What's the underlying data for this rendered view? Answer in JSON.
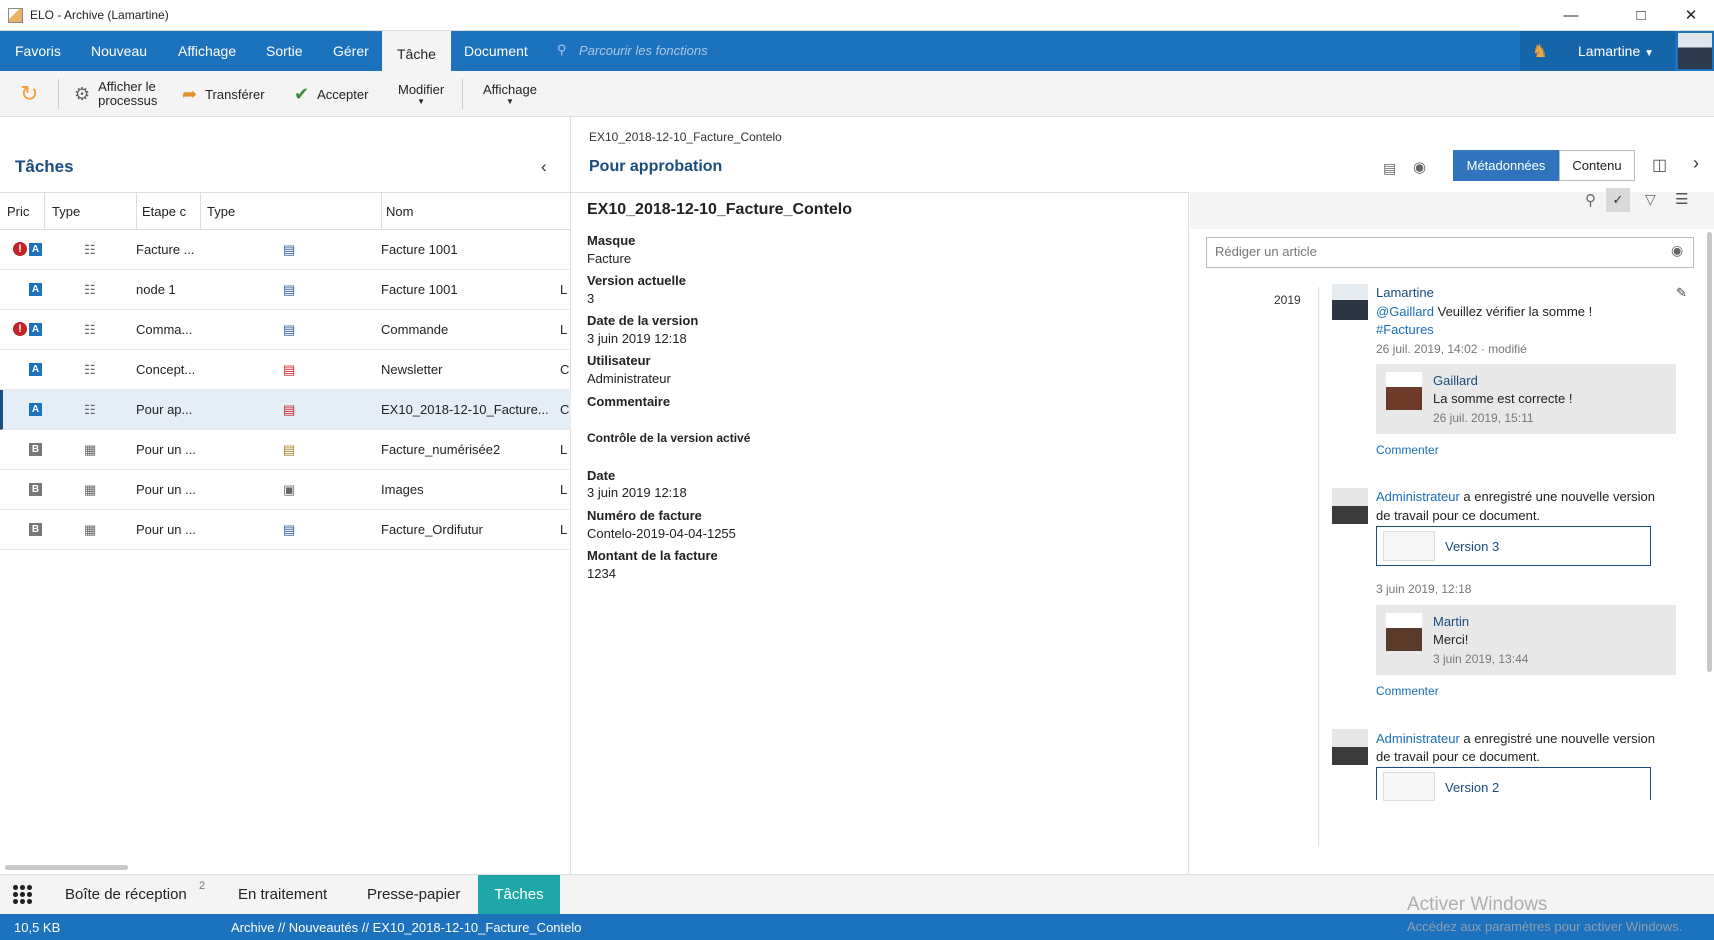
{
  "window": {
    "title": "ELO - Archive (Lamartine)"
  },
  "ribbon": {
    "tabs": [
      "Favoris",
      "Nouveau",
      "Affichage",
      "Sortie",
      "Gérer",
      "Tâche",
      "Document"
    ],
    "active": "Tâche",
    "search_placeholder": "Parcourir les fonctions",
    "user": "Lamartine"
  },
  "toolbar": {
    "refresh": "",
    "process": "Afficher le processus",
    "process_l1": "Afficher le",
    "process_l2": "processus",
    "transfer": "Transférer",
    "accept": "Accepter",
    "modify": "Modifier",
    "display": "Affichage"
  },
  "left": {
    "title": "Tâches",
    "columns": [
      "Pric",
      "Type",
      "Etape c",
      "Type",
      "Nom"
    ],
    "rows": [
      {
        "warn": true,
        "badge": "A",
        "step": "Facture ...",
        "name": "Facture 1001",
        "extra": ""
      },
      {
        "warn": false,
        "badge": "A",
        "step": "node 1",
        "name": "Facture 1001",
        "extra": "L"
      },
      {
        "warn": true,
        "badge": "A",
        "step": "Comma...",
        "name": "Commande",
        "extra": "L"
      },
      {
        "warn": false,
        "badge": "A",
        "step": "Concept...",
        "name": "Newsletter",
        "extra": "C"
      },
      {
        "warn": false,
        "badge": "A",
        "step": "Pour ap...",
        "name": "EX10_2018-12-10_Facture...",
        "extra": "C"
      },
      {
        "warn": false,
        "badge": "B",
        "step": "Pour un ...",
        "name": "Facture_numérisée2",
        "extra": "L"
      },
      {
        "warn": false,
        "badge": "B",
        "step": "Pour un ...",
        "name": "Images",
        "extra": "L"
      },
      {
        "warn": false,
        "badge": "B",
        "step": "Pour un ...",
        "name": "Facture_Ordifutur",
        "extra": "L"
      }
    ]
  },
  "doc": {
    "path": "EX10_2018-12-10_Facture_Contelo",
    "task": "Pour approbation",
    "metadata_tab": "Métadonnées",
    "content_tab": "Contenu",
    "title": "EX10_2018-12-10_Facture_Contelo"
  },
  "meta": {
    "masque_l": "Masque",
    "masque_v": "Facture",
    "ver_l": "Version actuelle",
    "ver_v": "3",
    "date_l": "Date de la version",
    "date_v": "3 juin 2019 12:18",
    "user_l": "Utilisateur",
    "user_v": "Administrateur",
    "comment_l": "Commentaire",
    "control": "Contrôle de la version activé",
    "d_l": "Date",
    "d_v": "3 juin 2019 12:18",
    "num_l": "Numéro de facture",
    "num_v": "Contelo-2019-04-04-1255",
    "amt_l": "Montant de la facture",
    "amt_v": "1234"
  },
  "feed": {
    "placeholder": "Rédiger un article",
    "year": "2019",
    "post1": {
      "author": "Lamartine",
      "mention": "@Gaillard",
      "text": " Veuillez vérifier la somme !",
      "tag": "#Factures",
      "time": "26 juil. 2019, 14:02",
      "modified": "· modifié",
      "reply": {
        "author": "Gaillard",
        "text": "La somme est correcte !",
        "time": "26 juil. 2019, 15:11"
      },
      "comment": "Commenter"
    },
    "post2": {
      "author": "Administrateur",
      "text": " a enregistré une nouvelle version",
      "text2": "de travail pour ce document.",
      "version": "Version 3",
      "time": "3 juin 2019, 12:18",
      "reply": {
        "author": "Martin",
        "text": "Merci!",
        "time": "3 juin 2019, 13:44"
      },
      "comment": "Commenter"
    },
    "post3": {
      "author": "Administrateur",
      "text": " a enregistré une nouvelle version",
      "text2": "de travail pour ce document.",
      "version": "Version 2"
    }
  },
  "bottom": {
    "inbox": "Boîte de réception",
    "inbox_count": "2",
    "in_progress": "En traitement",
    "clipboard": "Presse-papier",
    "tasks": "Tâches"
  },
  "status": {
    "size": "10,5 KB",
    "path": "Archive // Nouveautés // EX10_2018-12-10_Facture_Contelo"
  },
  "watermark": {
    "l1": "Activer Windows",
    "l2": "Accédez aux paramètres pour activer Windows."
  }
}
